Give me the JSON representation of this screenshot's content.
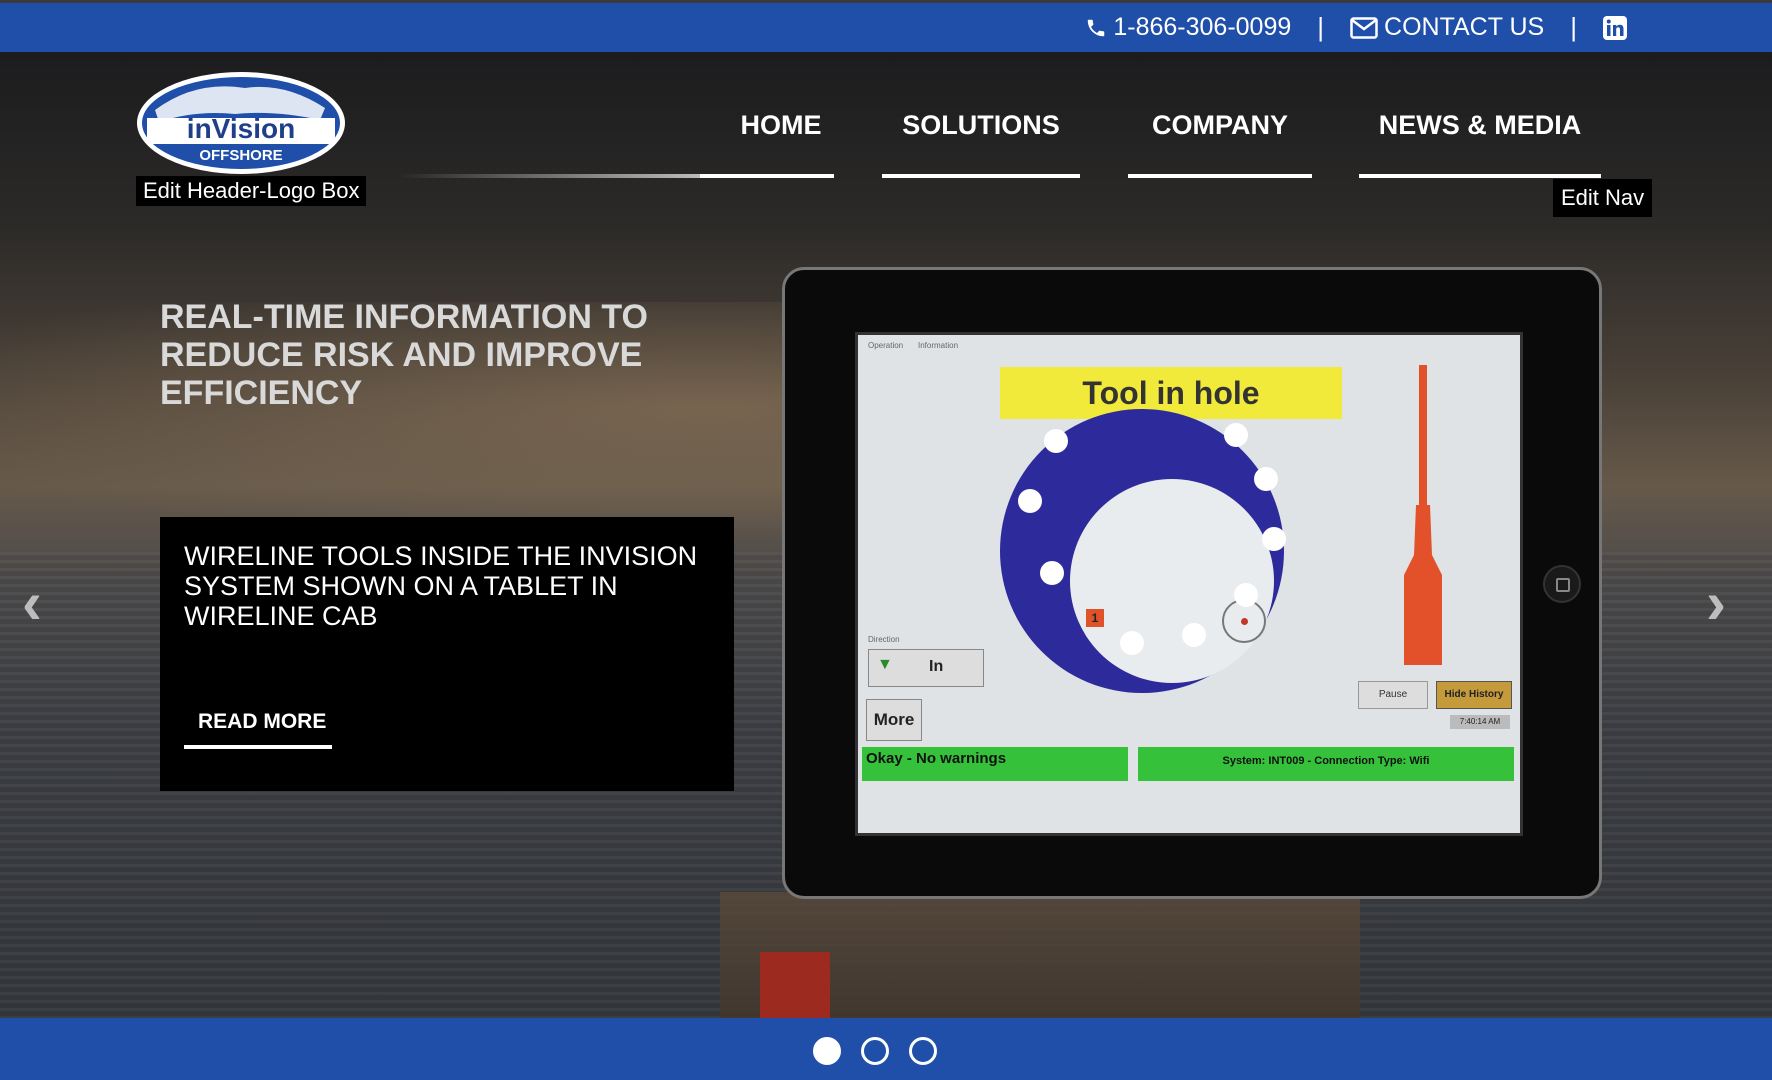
{
  "topbar": {
    "phone": "1-866-306-0099",
    "contact_label": "CONTACT US",
    "separator": "|",
    "icons": [
      "phone-icon",
      "envelope-icon",
      "linkedin-icon"
    ],
    "color": "#1f4fa8"
  },
  "header": {
    "logo_text": "inVision",
    "logo_subtext": "OFFSHORE",
    "edit_logo_label": "Edit Header-Logo Box",
    "edit_nav_label": "Edit Nav"
  },
  "nav": {
    "items": [
      {
        "label": "HOME"
      },
      {
        "label": "SOLUTIONS"
      },
      {
        "label": "COMPANY"
      },
      {
        "label": "NEWS & MEDIA"
      }
    ]
  },
  "hero": {
    "headline": "REAL-TIME INFORMATION TO REDUCE RISK AND IMPROVE EFFICIENCY",
    "caption": "WIRELINE TOOLS INSIDE THE INVISION SYSTEM SHOWN ON A TABLET IN WIRELINE CAB",
    "read_more": "READ MORE",
    "prev_arrow": "‹",
    "next_arrow": "›"
  },
  "tablet_screen": {
    "tab_operation": "Operation",
    "tab_information": "Information",
    "title": "Tool in hole",
    "direction_label": "Direction",
    "direction_value": "In",
    "more_label": "More",
    "status_ok": "Okay - No warnings",
    "status_system": "System: INT009 - Connection Type: Wifi",
    "pause_label": "Pause",
    "hide_history_label": "Hide History",
    "time": "7:40:14 AM",
    "marker": "1"
  },
  "carousel": {
    "slide_count": 3,
    "active_index": 0
  }
}
